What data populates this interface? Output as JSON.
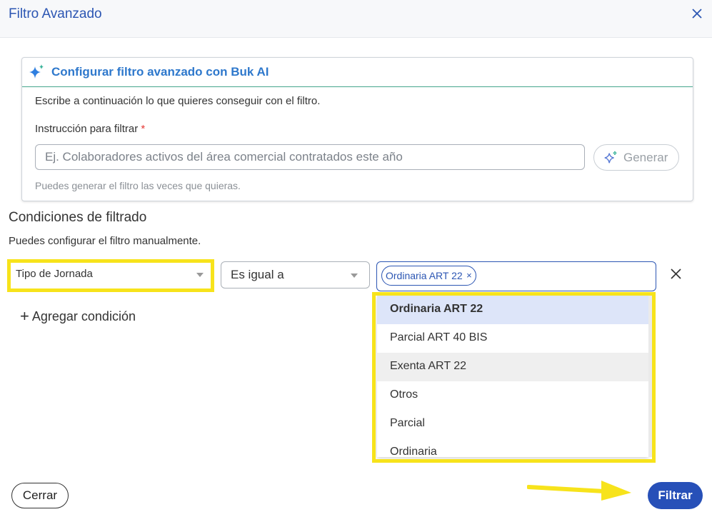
{
  "header": {
    "title": "Filtro Avanzado"
  },
  "ai_card": {
    "title": "Configurar filtro avanzado con Buk AI",
    "description": "Escribe a continuación lo que quieres conseguir con el filtro.",
    "instruction_label": "Instrucción para filtrar",
    "required_mark": "*",
    "instruction_placeholder": "Ej. Colaboradores activos del área comercial contratados este año",
    "instruction_value": "",
    "generate_label": "Generar",
    "hint": "Puedes generar el filtro las veces que quieras."
  },
  "conditions": {
    "title": "Condiciones de filtrado",
    "description": "Puedes configurar el filtro manualmente.",
    "field_value": "Tipo de Jornada",
    "operator_value": "Es igual a",
    "selected_chip": "Ordinaria ART 22",
    "chip_remove": "×",
    "add_label": "Agregar condición",
    "add_symbol": "+"
  },
  "dropdown": {
    "options": [
      "Ordinaria ART 22",
      "Parcial ART 40 BIS",
      "Exenta ART 22",
      "Otros",
      "Parcial",
      "Ordinaria"
    ],
    "selected_index": 0,
    "hover_index": 2
  },
  "footer": {
    "close_label": "Cerrar",
    "submit_label": "Filtrar"
  },
  "colors": {
    "brand": "#2750b8",
    "highlight": "#f7e31b",
    "ai_title": "#2e78cc"
  }
}
